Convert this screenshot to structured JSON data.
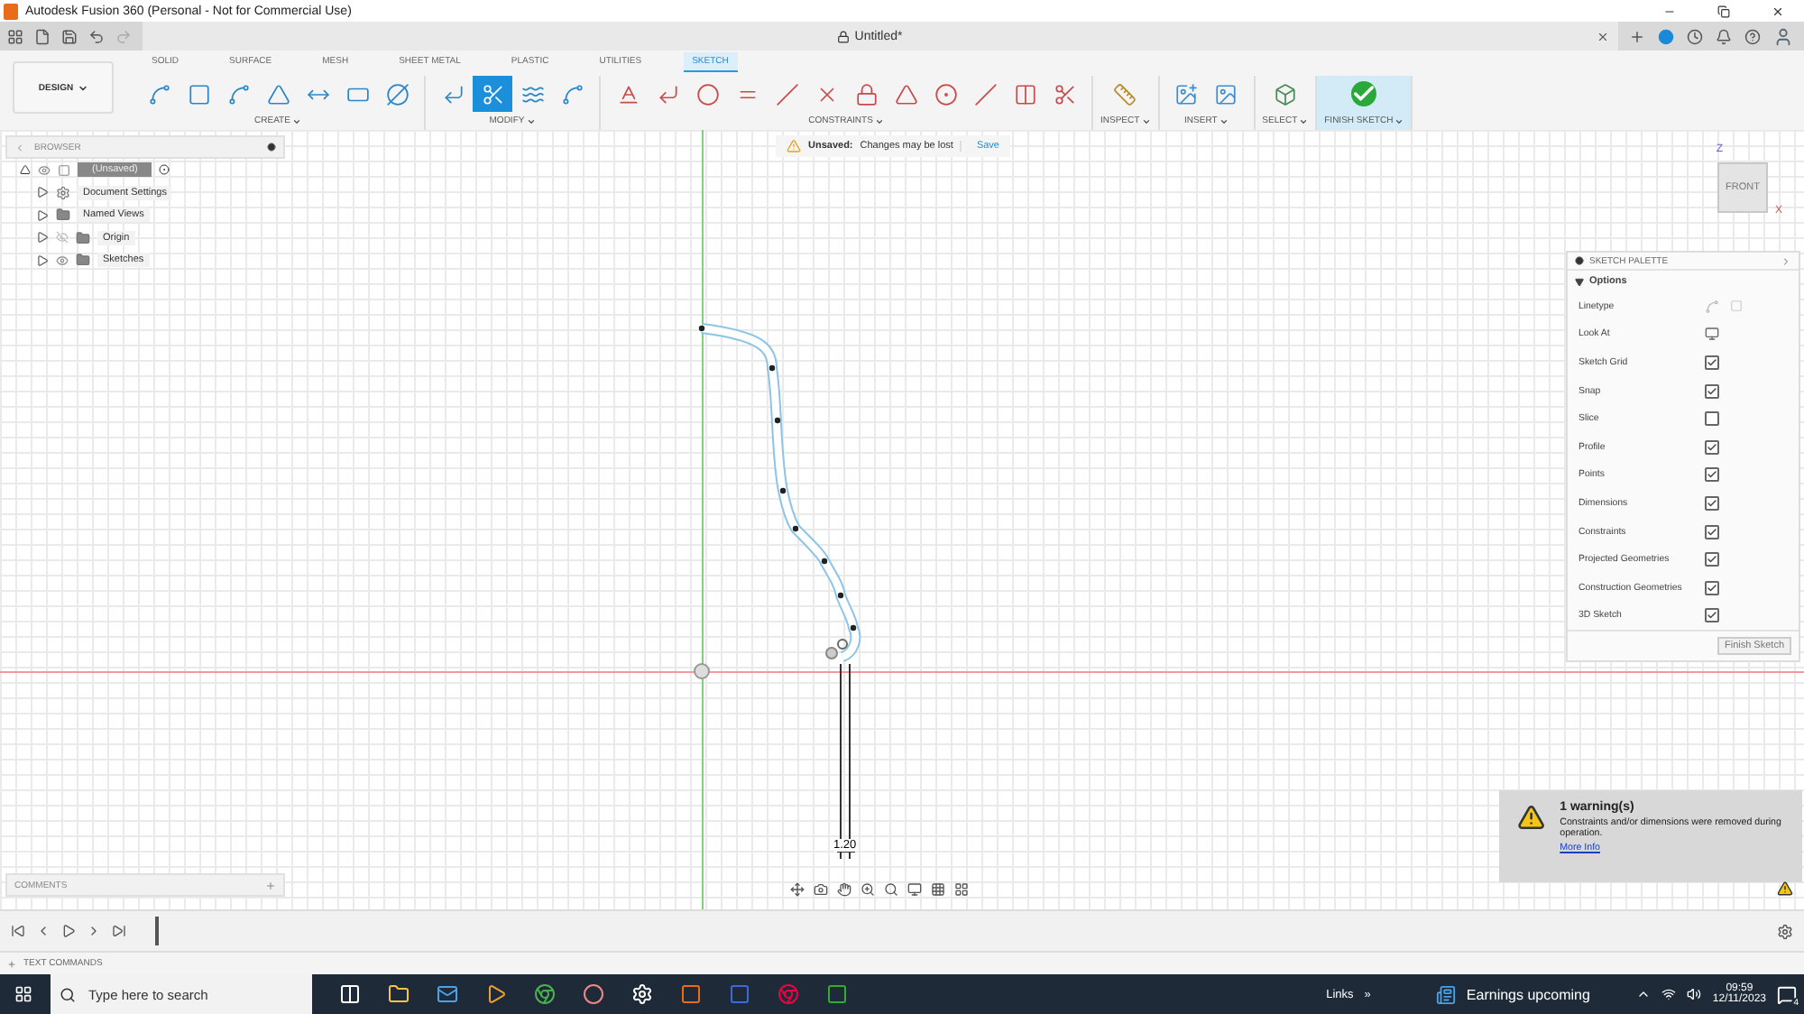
{
  "window": {
    "title": "Autodesk Fusion 360 (Personal - Not for Commercial Use)"
  },
  "document": {
    "title": "Untitled*"
  },
  "workspace": {
    "label": "DESIGN"
  },
  "tabs": [
    {
      "label": "SOLID",
      "selected": false
    },
    {
      "label": "SURFACE",
      "selected": false
    },
    {
      "label": "MESH",
      "selected": false
    },
    {
      "label": "SHEET METAL",
      "selected": false
    },
    {
      "label": "PLASTIC",
      "selected": false
    },
    {
      "label": "UTILITIES",
      "selected": false
    },
    {
      "label": "SKETCH",
      "selected": true
    }
  ],
  "groups": [
    {
      "label": "CREATE",
      "tools": [
        {
          "selected": false
        },
        {
          "selected": false
        },
        {
          "selected": false
        },
        {
          "selected": false
        },
        {
          "selected": false
        },
        {
          "selected": false
        },
        {
          "selected": false
        }
      ]
    },
    {
      "label": "MODIFY",
      "tools": [
        {
          "selected": false
        },
        {
          "selected": true
        },
        {
          "selected": false
        },
        {
          "selected": false
        }
      ]
    },
    {
      "label": "CONSTRAINTS",
      "tools": [
        {
          "selected": false
        },
        {
          "selected": false
        },
        {
          "selected": false
        },
        {
          "selected": false
        },
        {
          "selected": false
        },
        {
          "selected": false
        },
        {
          "selected": false
        },
        {
          "selected": false
        },
        {
          "selected": false
        },
        {
          "selected": false
        },
        {
          "selected": false
        },
        {
          "selected": false
        }
      ]
    },
    {
      "label": "INSPECT",
      "tools": [
        {
          "selected": false
        }
      ]
    },
    {
      "label": "INSERT",
      "tools": [
        {
          "selected": false
        },
        {
          "selected": false
        }
      ]
    },
    {
      "label": "SELECT",
      "tools": [
        {
          "selected": false
        }
      ]
    },
    {
      "label": "FINISH SKETCH",
      "tools": [
        {
          "selected": false
        }
      ]
    }
  ],
  "banner": {
    "label": "Unsaved:",
    "message": "Changes may be lost",
    "action": "Save"
  },
  "browser": {
    "title": "BROWSER",
    "root": "(Unsaved)",
    "items": [
      {
        "label": "Document Settings",
        "kind": "settings"
      },
      {
        "label": "Named Views",
        "kind": "folder"
      },
      {
        "label": "Origin",
        "kind": "hidden-folder"
      },
      {
        "label": "Sketches",
        "kind": "visible-folder"
      }
    ]
  },
  "view_cube": {
    "face": "FRONT",
    "axis_z": "Z",
    "axis_x": "X"
  },
  "dimension": "1.20",
  "palette": {
    "title": "SKETCH PALETTE",
    "section": "Options",
    "options": [
      {
        "label": "Linetype",
        "kind": "linetype"
      },
      {
        "label": "Look At",
        "kind": "look-at"
      },
      {
        "label": "Sketch Grid",
        "kind": "checkbox",
        "checked": true
      },
      {
        "label": "Snap",
        "kind": "checkbox",
        "checked": true
      },
      {
        "label": "Slice",
        "kind": "checkbox",
        "checked": false
      },
      {
        "label": "Profile",
        "kind": "checkbox",
        "checked": true
      },
      {
        "label": "Points",
        "kind": "checkbox",
        "checked": true
      },
      {
        "label": "Dimensions",
        "kind": "checkbox",
        "checked": true
      },
      {
        "label": "Constraints",
        "kind": "checkbox",
        "checked": true
      },
      {
        "label": "Projected Geometries",
        "kind": "checkbox",
        "checked": true
      },
      {
        "label": "Construction Geometries",
        "kind": "checkbox",
        "checked": true
      },
      {
        "label": "3D Sketch",
        "kind": "checkbox",
        "checked": true
      }
    ],
    "button": "Finish Sketch"
  },
  "warning": {
    "title": "1 warning(s)",
    "message": "Constraints and/or dimensions were removed during operation.",
    "link": "More Info"
  },
  "comments": {
    "title": "COMMENTS"
  },
  "text_commands": {
    "title": "TEXT COMMANDS"
  },
  "taskbar": {
    "search_placeholder": "Type here to search",
    "links": "Links",
    "chevron": "»",
    "news": "Earnings upcoming",
    "time": "09:59",
    "date": "12/11/2023",
    "badge": "4"
  }
}
